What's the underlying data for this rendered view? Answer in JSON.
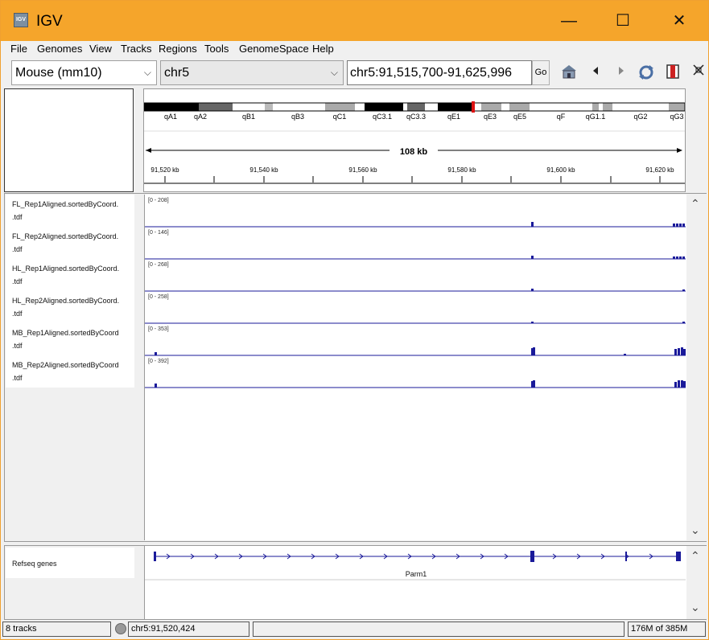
{
  "window": {
    "title": "IGV",
    "minimize": "—",
    "maximize": "☐",
    "close": "✕",
    "app_icon_text": "IGV"
  },
  "menu": [
    "File",
    "Genomes",
    "View",
    "Tracks",
    "Regions",
    "Tools",
    "GenomeSpace",
    "Help"
  ],
  "toolbar": {
    "genome": "Mouse (mm10)",
    "chromosome": "chr5",
    "locus": "chr5:91,515,700-91,625,996",
    "go_label": "Go"
  },
  "ideogram": {
    "bands": [
      "qA1",
      "qA2",
      "qB1",
      "qB3",
      "qC1",
      "qC3.1",
      "qC3.3",
      "qE1",
      "qE3",
      "qE5",
      "qF",
      "qG1.1",
      "qG2",
      "qG3"
    ]
  },
  "ruler": {
    "span_label": "108 kb",
    "ticks": [
      "91,520 kb",
      "91,540 kb",
      "91,560 kb",
      "91,580 kb",
      "91,600 kb",
      "91,620 kb"
    ]
  },
  "tracks": [
    {
      "name": "FL_Rep1Aligned.sortedByCoord.",
      "name2": ".tdf",
      "range": "[0 - 208]"
    },
    {
      "name": "FL_Rep2Aligned.sortedByCoord.",
      "name2": ".tdf",
      "range": "[0 - 146]"
    },
    {
      "name": "HL_Rep1Aligned.sortedByCoord.",
      "name2": ".tdf",
      "range": "[0 - 268]"
    },
    {
      "name": "HL_Rep2Aligned.sortedByCoord.",
      "name2": ".tdf",
      "range": "[0 - 258]"
    },
    {
      "name": "MB_Rep1Aligned.sortedByCoord",
      "name2": ".tdf",
      "range": "[0 - 353]"
    },
    {
      "name": "MB_Rep2Aligned.sortedByCoord",
      "name2": ".tdf",
      "range": "[0 - 392]"
    }
  ],
  "feature_track": {
    "name": "Refseq genes",
    "gene": "Parm1"
  },
  "status": {
    "tracks": "8 tracks",
    "position": "chr5:91,520,424",
    "message": "",
    "memory": "176M of 385M"
  },
  "colors": {
    "title_bar": "#f5a52b",
    "track": "#1a1a9a",
    "centromere": "#dd1111"
  }
}
